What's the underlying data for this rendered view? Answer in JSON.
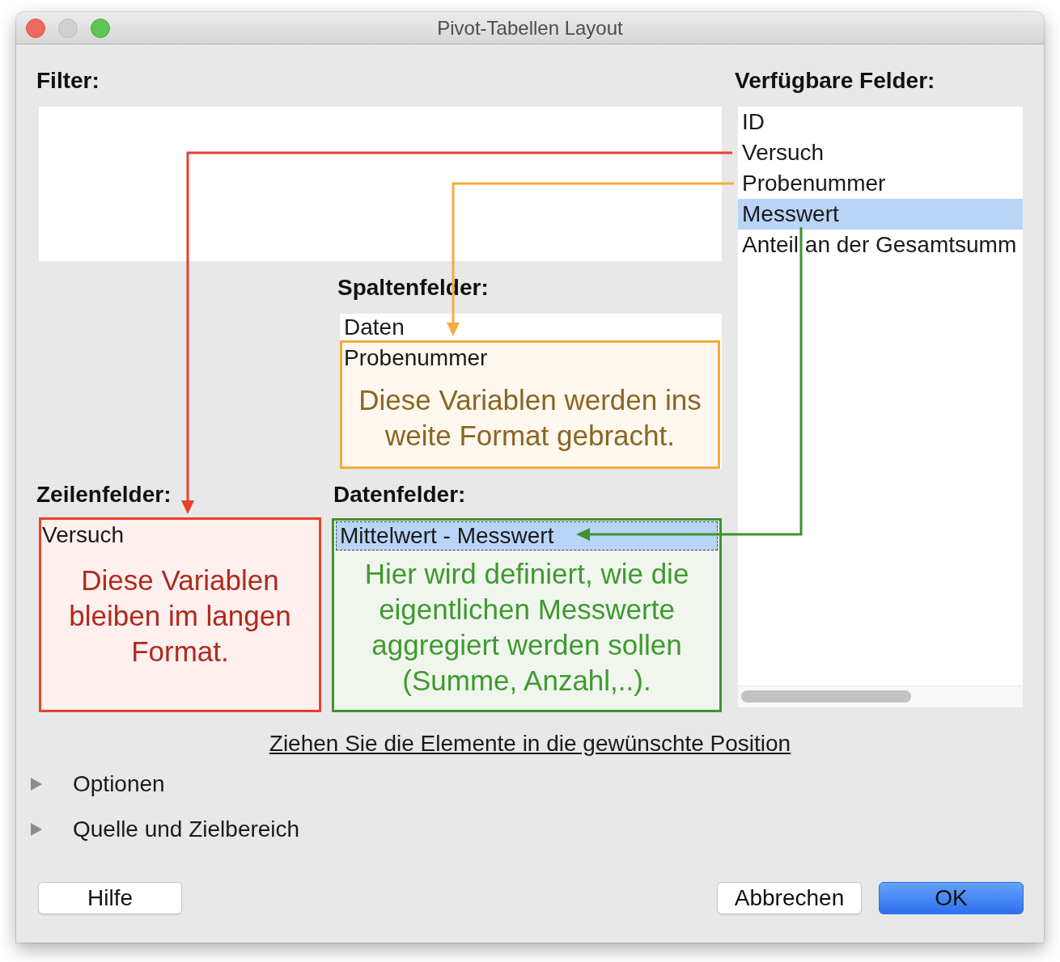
{
  "window": {
    "title": "Pivot-Tabellen Layout",
    "controls": [
      {
        "kind": "close",
        "disabled": false
      },
      {
        "kind": "minimize",
        "disabled": true
      },
      {
        "kind": "zoom",
        "disabled": false
      }
    ]
  },
  "filter": {
    "label": "Filter:"
  },
  "available_fields": {
    "label": "Verfügbare Felder:",
    "items": [
      {
        "label": "ID",
        "selected": false
      },
      {
        "label": "Versuch",
        "selected": false
      },
      {
        "label": "Probenummer",
        "selected": false
      },
      {
        "label": "Messwert",
        "selected": true
      },
      {
        "label": "Anteil an der Gesamtsumm",
        "selected": false
      }
    ]
  },
  "column_fields": {
    "label": "Spaltenfelder:",
    "items": [
      {
        "label": "Daten",
        "selected": false
      }
    ],
    "callout": {
      "color": "#f2ad3d",
      "items": [
        {
          "label": "Probenummer",
          "selected": false
        }
      ],
      "note": {
        "text": "Diese Variablen werden ins weite Format gebracht.",
        "color": "#8c6422"
      }
    }
  },
  "row_fields": {
    "label": "Zeilenfelder:",
    "callout": {
      "color": "#e8412a",
      "items": [
        {
          "label": "Versuch",
          "selected": false
        }
      ],
      "note": {
        "text": "Diese Variablen bleiben im langen Format.",
        "color": "#b0291d"
      }
    }
  },
  "data_fields": {
    "label": "Datenfelder:",
    "callout": {
      "color": "#3f922f",
      "items": [
        {
          "label": "Mittelwert - Messwert",
          "selected": true,
          "focused": true
        }
      ],
      "note": {
        "text": "Hier wird definiert, wie die eigentlichen Messwerte aggregiert werden sollen (Summe, Anzahl,..).",
        "color": "#3f9a2e"
      }
    }
  },
  "hint": "Ziehen Sie die Elemente in die gewünschte Position",
  "sections": [
    {
      "label": "Optionen",
      "expanded": false
    },
    {
      "label": "Quelle und Zielbereich",
      "expanded": false
    }
  ],
  "buttons": [
    {
      "label": "Hilfe",
      "default": false
    },
    {
      "label": "Abbrechen",
      "default": false
    },
    {
      "label": "OK",
      "default": true
    }
  ]
}
